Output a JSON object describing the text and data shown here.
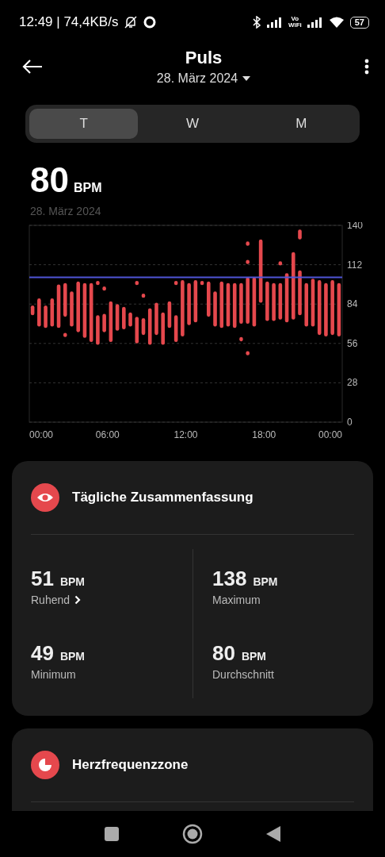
{
  "status_bar": {
    "time": "12:49 | 74,4KB/s",
    "wifi_calling_top": "Vo",
    "wifi_calling_bottom": "WiFi",
    "battery": "57"
  },
  "header": {
    "title": "Puls",
    "date": "28. März 2024"
  },
  "tabs": [
    {
      "label": "T",
      "selected": true
    },
    {
      "label": "W",
      "selected": false
    },
    {
      "label": "M",
      "selected": false
    }
  ],
  "current": {
    "value": "80",
    "unit": "BPM",
    "date": "28. März 2024"
  },
  "chart": {
    "chart_data": {
      "type": "candlestick",
      "grid": true,
      "x": [
        0.25,
        0.75,
        1.25,
        1.75,
        2.25,
        2.75,
        3.25,
        3.75,
        4.25,
        4.75,
        5.25,
        5.75,
        6.25,
        6.75,
        7.25,
        7.75,
        8.25,
        8.75,
        9.25,
        9.75,
        10.25,
        10.75,
        11.25,
        11.75,
        12.25,
        12.75,
        13.25,
        13.75,
        14.25,
        14.75,
        15.25,
        15.75,
        16.25,
        16.75,
        17.25,
        17.75,
        18.25,
        18.75,
        19.25,
        19.75,
        20.25,
        20.75,
        21.25,
        21.75,
        22.25,
        22.75,
        23.25,
        23.75
      ],
      "xlim": [
        0,
        24
      ],
      "ylim": [
        0,
        140
      ],
      "yticks": [
        0,
        28,
        56,
        84,
        112,
        140
      ],
      "xticks": [
        {
          "value": 0,
          "label": "00:00"
        },
        {
          "value": 6,
          "label": "06:00"
        },
        {
          "value": 12,
          "label": "12:00"
        },
        {
          "value": 18,
          "label": "18:00"
        },
        {
          "value": 24,
          "label": "00:00"
        }
      ],
      "series": [
        {
          "color": "#e5484d",
          "ohlc": [
            [
              76,
              83,
              76,
              83
            ],
            [
              68,
              88,
              68,
              88
            ],
            [
              67,
              83,
              67,
              83
            ],
            [
              68,
              88,
              68,
              88
            ],
            [
              67,
              98,
              67,
              98
            ],
            [
              75,
              99,
              75,
              99
            ],
            [
              68,
              93,
              68,
              93
            ],
            [
              64,
              100,
              64,
              100
            ],
            [
              60,
              99,
              60,
              99
            ],
            [
              57,
              99,
              57,
              99
            ],
            [
              55,
              76,
              55,
              76
            ],
            [
              64,
              77,
              64,
              77
            ],
            [
              57,
              86,
              57,
              86
            ],
            [
              65,
              84,
              65,
              84
            ],
            [
              66,
              82,
              66,
              82
            ],
            [
              68,
              78,
              68,
              78
            ],
            [
              56,
              75,
              56,
              75
            ],
            [
              62,
              74,
              62,
              74
            ],
            [
              55,
              81,
              55,
              81
            ],
            [
              62,
              85,
              62,
              85
            ],
            [
              55,
              78,
              55,
              78
            ],
            [
              67,
              86,
              67,
              86
            ],
            [
              57,
              76,
              57,
              76
            ],
            [
              61,
              101,
              61,
              101
            ],
            [
              69,
              99,
              69,
              99
            ],
            [
              71,
              101,
              71,
              101
            ],
            null,
            [
              75,
              100,
              75,
              100
            ],
            [
              68,
              93,
              68,
              93
            ],
            [
              67,
              100,
              67,
              100
            ],
            [
              68,
              99,
              68,
              99
            ],
            [
              67,
              99,
              67,
              99
            ],
            [
              70,
              99,
              70,
              99
            ],
            [
              70,
              103,
              70,
              103
            ],
            [
              68,
              103,
              68,
              103
            ],
            [
              85,
              130,
              85,
              130
            ],
            [
              72,
              100,
              72,
              100
            ],
            [
              72,
              99,
              72,
              99
            ],
            [
              73,
              99,
              73,
              99
            ],
            [
              71,
              106,
              71,
              106
            ],
            [
              73,
              121,
              73,
              121
            ],
            [
              76,
              108,
              76,
              108
            ],
            [
              68,
              99,
              68,
              99
            ],
            [
              68,
              102,
              68,
              102
            ],
            [
              62,
              101,
              62,
              101
            ],
            [
              61,
              99,
              61,
              99
            ],
            [
              62,
              101,
              62,
              101
            ],
            [
              61,
              99,
              61,
              99
            ]
          ]
        },
        {
          "color": "#e5484d",
          "ohlc": [
            null,
            null,
            null,
            null,
            null,
            [
              60.5,
              63.5,
              60.5,
              63.5
            ],
            null,
            null,
            null,
            null,
            [
              97.5,
              100.5,
              97.5,
              100.5
            ],
            [
              93.5,
              96.5,
              93.5,
              96.5
            ],
            null,
            null,
            null,
            null,
            [
              97.5,
              100.5,
              97.5,
              100.5
            ],
            [
              88.5,
              91.5,
              88.5,
              91.5
            ],
            null,
            null,
            null,
            null,
            [
              97.5,
              100.5,
              97.5,
              100.5
            ],
            null,
            null,
            null,
            [
              97.5,
              100.5,
              97.5,
              100.5
            ],
            null,
            null,
            null,
            null,
            null,
            [
              57.5,
              60.5,
              57.5,
              60.5
            ],
            [
              125.5,
              128.5,
              125.5,
              128.5
            ],
            null,
            null,
            null,
            null,
            [
              111.5,
              114.5,
              111.5,
              114.5
            ],
            null,
            null,
            [
              130,
              137,
              130,
              137
            ],
            null,
            null,
            null,
            null,
            null,
            null
          ]
        },
        {
          "color": "#e5484d",
          "ohlc": [
            null,
            null,
            null,
            null,
            null,
            null,
            null,
            null,
            null,
            null,
            null,
            null,
            null,
            null,
            null,
            null,
            null,
            null,
            null,
            null,
            null,
            null,
            null,
            null,
            null,
            null,
            null,
            null,
            null,
            null,
            null,
            null,
            null,
            [
              112.5,
              115.5,
              112.5,
              115.5
            ],
            null,
            null,
            null,
            null,
            null,
            null,
            null,
            null,
            null,
            null,
            null,
            null,
            null,
            null
          ]
        },
        {
          "color": "#e5484d",
          "ohlc": [
            null,
            null,
            null,
            null,
            null,
            null,
            null,
            null,
            null,
            null,
            null,
            null,
            null,
            null,
            null,
            null,
            null,
            null,
            null,
            null,
            null,
            null,
            null,
            null,
            null,
            null,
            null,
            null,
            null,
            null,
            null,
            null,
            null,
            [
              47.5,
              50.5,
              47.5,
              50.5
            ],
            null,
            null,
            null,
            null,
            null,
            null,
            null,
            null,
            null,
            null,
            null,
            null,
            null,
            null
          ]
        }
      ],
      "ref_lines": [
        {
          "axis": "y",
          "value": 103,
          "color": "#4f55d6"
        }
      ]
    }
  },
  "summary": {
    "title": "Tägliche Zusammenfassung",
    "stats": [
      {
        "value": "51",
        "unit": "BPM",
        "label": "Ruhend",
        "link": true
      },
      {
        "value": "138",
        "unit": "BPM",
        "label": "Maximum",
        "link": false
      },
      {
        "value": "49",
        "unit": "BPM",
        "label": "Minimum",
        "link": false
      },
      {
        "value": "80",
        "unit": "BPM",
        "label": "Durchschnitt",
        "link": false
      }
    ]
  },
  "zones": {
    "title": "Herzfrequenzzone"
  }
}
